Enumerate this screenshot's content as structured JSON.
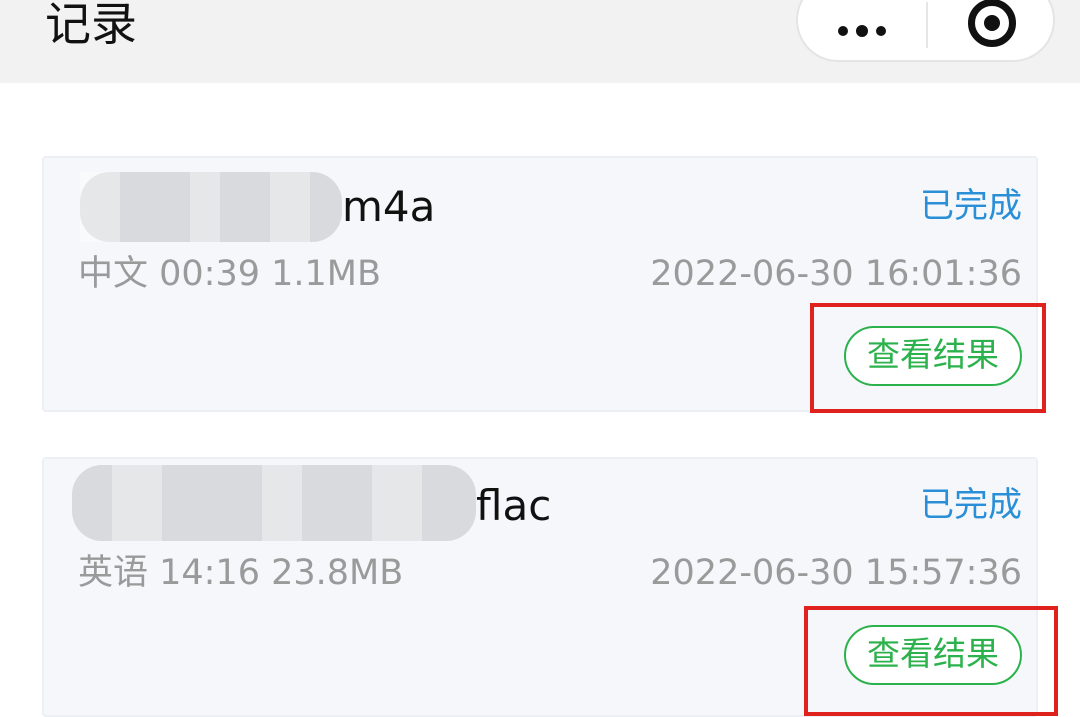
{
  "header": {
    "title": "记录"
  },
  "records": [
    {
      "filename_suffix": "m4a",
      "status": "已完成",
      "meta": "中文 00:39 1.1MB",
      "datetime": "2022-06-30 16:01:36",
      "action_label": "查看结果"
    },
    {
      "filename_suffix": "flac",
      "status": "已完成",
      "meta": "英语 14:16 23.8MB",
      "datetime": "2022-06-30 15:57:36",
      "action_label": "查看结果"
    }
  ],
  "colors": {
    "status": "#2a8fd6",
    "action": "#2bb24c",
    "highlight": "#e0221e",
    "meta": "#9a9a9a"
  },
  "icons": {
    "more": "more-dots-icon",
    "close": "close-miniprogram-icon"
  }
}
